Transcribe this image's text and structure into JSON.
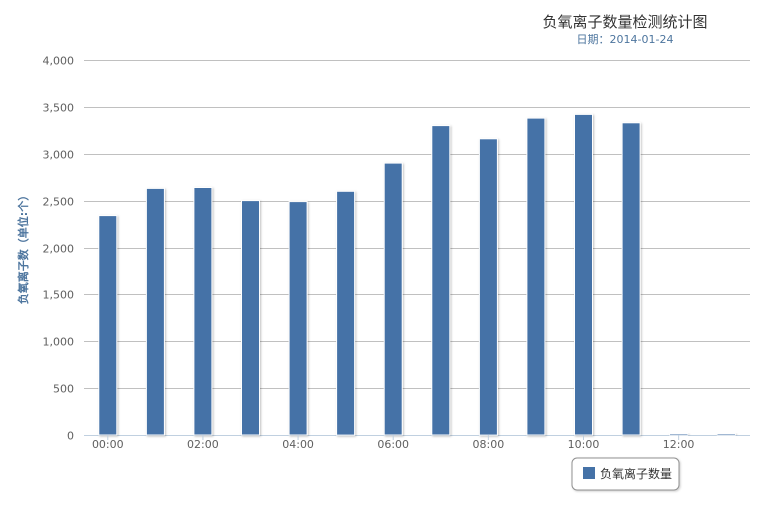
{
  "colors": {
    "bar": "#4572A7",
    "grid": "#C0C0C0",
    "axis": "#C0D0E0",
    "title": "#333333",
    "subtitle": "#4d759e"
  },
  "chart_data": {
    "type": "bar",
    "title": "负氧离子数量检测统计图",
    "subtitle": "日期：2014-01-24",
    "ylabel": "负氧离子数（单位:个）",
    "xlabel": "",
    "ylim": [
      0,
      4000
    ],
    "yticks": [
      "0",
      "500",
      "1,000",
      "1,500",
      "2,000",
      "2,500",
      "3,000",
      "3,500",
      "4,000"
    ],
    "ytick_values": [
      0,
      500,
      1000,
      1500,
      2000,
      2500,
      3000,
      3500,
      4000
    ],
    "xtick_labels": [
      "00:00",
      "02:00",
      "04:00",
      "06:00",
      "08:00",
      "10:00",
      "12:00"
    ],
    "categories": [
      "00:00",
      "01:00",
      "02:00",
      "03:00",
      "04:00",
      "05:00",
      "06:00",
      "07:00",
      "08:00",
      "09:00",
      "10:00",
      "11:00",
      "12:00",
      "13:00"
    ],
    "series": [
      {
        "name": "负氧离子数量",
        "values": [
          2340,
          2630,
          2640,
          2500,
          2490,
          2600,
          2900,
          3300,
          3160,
          3380,
          3420,
          3330,
          0,
          0
        ]
      }
    ],
    "grid": true,
    "legend": "bottom-right"
  }
}
